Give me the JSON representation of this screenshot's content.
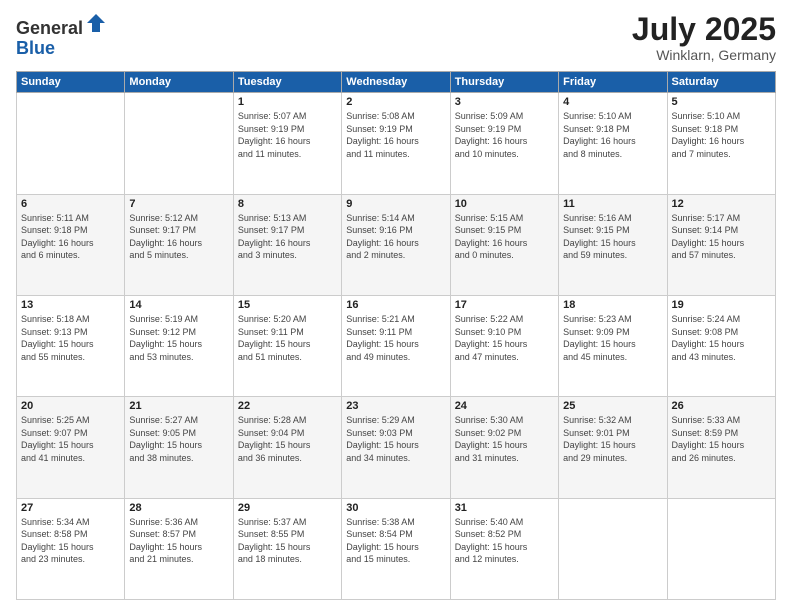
{
  "logo": {
    "general": "General",
    "blue": "Blue"
  },
  "header": {
    "month": "July 2025",
    "location": "Winklarn, Germany"
  },
  "weekdays": [
    "Sunday",
    "Monday",
    "Tuesday",
    "Wednesday",
    "Thursday",
    "Friday",
    "Saturday"
  ],
  "weeks": [
    [
      {
        "day": "",
        "info": ""
      },
      {
        "day": "",
        "info": ""
      },
      {
        "day": "1",
        "info": "Sunrise: 5:07 AM\nSunset: 9:19 PM\nDaylight: 16 hours\nand 11 minutes."
      },
      {
        "day": "2",
        "info": "Sunrise: 5:08 AM\nSunset: 9:19 PM\nDaylight: 16 hours\nand 11 minutes."
      },
      {
        "day": "3",
        "info": "Sunrise: 5:09 AM\nSunset: 9:19 PM\nDaylight: 16 hours\nand 10 minutes."
      },
      {
        "day": "4",
        "info": "Sunrise: 5:10 AM\nSunset: 9:18 PM\nDaylight: 16 hours\nand 8 minutes."
      },
      {
        "day": "5",
        "info": "Sunrise: 5:10 AM\nSunset: 9:18 PM\nDaylight: 16 hours\nand 7 minutes."
      }
    ],
    [
      {
        "day": "6",
        "info": "Sunrise: 5:11 AM\nSunset: 9:18 PM\nDaylight: 16 hours\nand 6 minutes."
      },
      {
        "day": "7",
        "info": "Sunrise: 5:12 AM\nSunset: 9:17 PM\nDaylight: 16 hours\nand 5 minutes."
      },
      {
        "day": "8",
        "info": "Sunrise: 5:13 AM\nSunset: 9:17 PM\nDaylight: 16 hours\nand 3 minutes."
      },
      {
        "day": "9",
        "info": "Sunrise: 5:14 AM\nSunset: 9:16 PM\nDaylight: 16 hours\nand 2 minutes."
      },
      {
        "day": "10",
        "info": "Sunrise: 5:15 AM\nSunset: 9:15 PM\nDaylight: 16 hours\nand 0 minutes."
      },
      {
        "day": "11",
        "info": "Sunrise: 5:16 AM\nSunset: 9:15 PM\nDaylight: 15 hours\nand 59 minutes."
      },
      {
        "day": "12",
        "info": "Sunrise: 5:17 AM\nSunset: 9:14 PM\nDaylight: 15 hours\nand 57 minutes."
      }
    ],
    [
      {
        "day": "13",
        "info": "Sunrise: 5:18 AM\nSunset: 9:13 PM\nDaylight: 15 hours\nand 55 minutes."
      },
      {
        "day": "14",
        "info": "Sunrise: 5:19 AM\nSunset: 9:12 PM\nDaylight: 15 hours\nand 53 minutes."
      },
      {
        "day": "15",
        "info": "Sunrise: 5:20 AM\nSunset: 9:11 PM\nDaylight: 15 hours\nand 51 minutes."
      },
      {
        "day": "16",
        "info": "Sunrise: 5:21 AM\nSunset: 9:11 PM\nDaylight: 15 hours\nand 49 minutes."
      },
      {
        "day": "17",
        "info": "Sunrise: 5:22 AM\nSunset: 9:10 PM\nDaylight: 15 hours\nand 47 minutes."
      },
      {
        "day": "18",
        "info": "Sunrise: 5:23 AM\nSunset: 9:09 PM\nDaylight: 15 hours\nand 45 minutes."
      },
      {
        "day": "19",
        "info": "Sunrise: 5:24 AM\nSunset: 9:08 PM\nDaylight: 15 hours\nand 43 minutes."
      }
    ],
    [
      {
        "day": "20",
        "info": "Sunrise: 5:25 AM\nSunset: 9:07 PM\nDaylight: 15 hours\nand 41 minutes."
      },
      {
        "day": "21",
        "info": "Sunrise: 5:27 AM\nSunset: 9:05 PM\nDaylight: 15 hours\nand 38 minutes."
      },
      {
        "day": "22",
        "info": "Sunrise: 5:28 AM\nSunset: 9:04 PM\nDaylight: 15 hours\nand 36 minutes."
      },
      {
        "day": "23",
        "info": "Sunrise: 5:29 AM\nSunset: 9:03 PM\nDaylight: 15 hours\nand 34 minutes."
      },
      {
        "day": "24",
        "info": "Sunrise: 5:30 AM\nSunset: 9:02 PM\nDaylight: 15 hours\nand 31 minutes."
      },
      {
        "day": "25",
        "info": "Sunrise: 5:32 AM\nSunset: 9:01 PM\nDaylight: 15 hours\nand 29 minutes."
      },
      {
        "day": "26",
        "info": "Sunrise: 5:33 AM\nSunset: 8:59 PM\nDaylight: 15 hours\nand 26 minutes."
      }
    ],
    [
      {
        "day": "27",
        "info": "Sunrise: 5:34 AM\nSunset: 8:58 PM\nDaylight: 15 hours\nand 23 minutes."
      },
      {
        "day": "28",
        "info": "Sunrise: 5:36 AM\nSunset: 8:57 PM\nDaylight: 15 hours\nand 21 minutes."
      },
      {
        "day": "29",
        "info": "Sunrise: 5:37 AM\nSunset: 8:55 PM\nDaylight: 15 hours\nand 18 minutes."
      },
      {
        "day": "30",
        "info": "Sunrise: 5:38 AM\nSunset: 8:54 PM\nDaylight: 15 hours\nand 15 minutes."
      },
      {
        "day": "31",
        "info": "Sunrise: 5:40 AM\nSunset: 8:52 PM\nDaylight: 15 hours\nand 12 minutes."
      },
      {
        "day": "",
        "info": ""
      },
      {
        "day": "",
        "info": ""
      }
    ]
  ]
}
